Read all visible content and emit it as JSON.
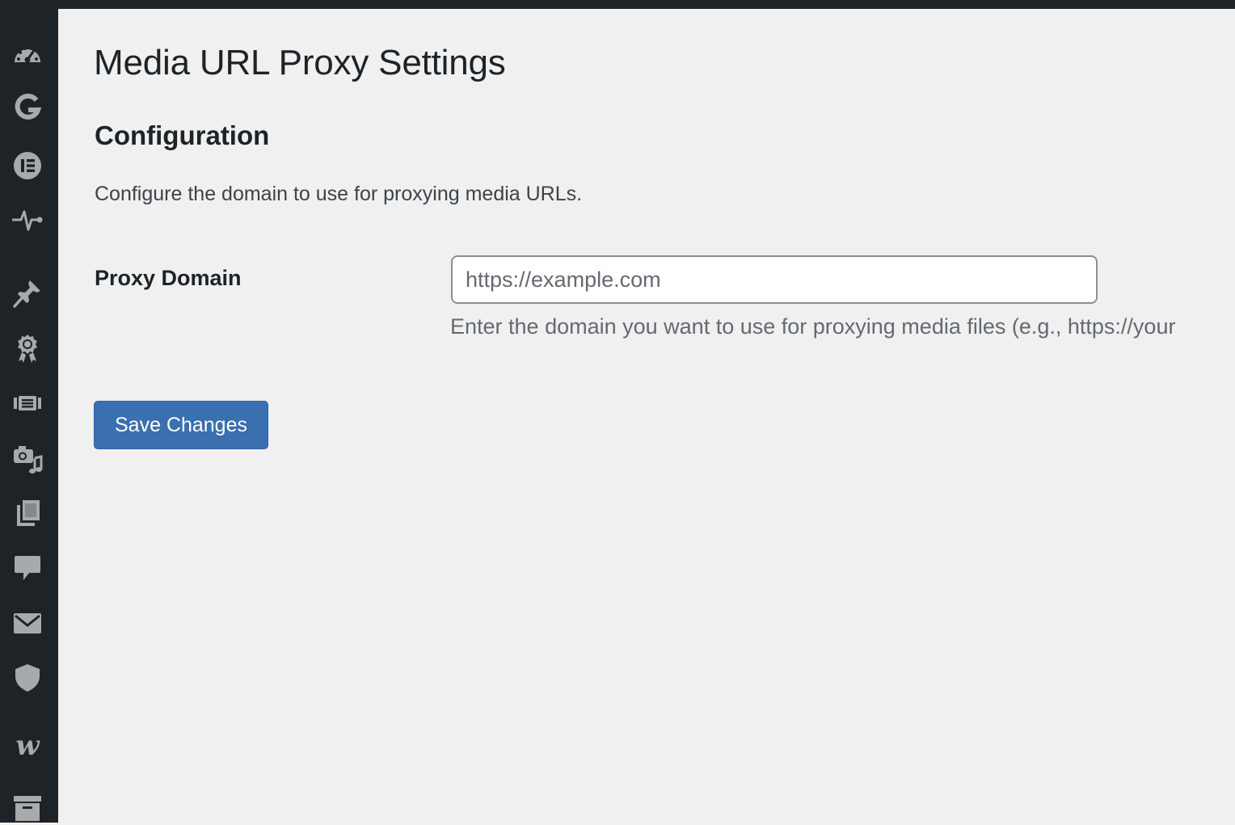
{
  "colors": {
    "sidebar_bg": "#1d2327",
    "page_bg": "#f0f0f1",
    "icon": "#a7aaad",
    "button_bg": "#3a6fb0",
    "button_text": "#ffffff"
  },
  "sidebar": {
    "items": [
      {
        "icon": "dashboard-icon"
      },
      {
        "icon": "google-g-icon"
      },
      {
        "icon": "elementor-icon"
      },
      {
        "icon": "activity-pulse-icon"
      },
      {
        "icon": "pushpin-icon"
      },
      {
        "icon": "award-ribbon-icon"
      },
      {
        "icon": "film-strip-icon"
      },
      {
        "icon": "media-camera-music-icon"
      },
      {
        "icon": "pages-icon"
      },
      {
        "icon": "comment-bubble-icon"
      },
      {
        "icon": "envelope-icon"
      },
      {
        "icon": "shield-icon"
      },
      {
        "icon": "w-logo-icon"
      },
      {
        "icon": "archive-box-icon"
      }
    ]
  },
  "page": {
    "title": "Media URL Proxy Settings"
  },
  "section": {
    "title": "Configuration",
    "description": "Configure the domain to use for proxying media URLs."
  },
  "field": {
    "label": "Proxy Domain",
    "value": "",
    "placeholder": "https://example.com",
    "help": "Enter the domain you want to use for proxying media files (e.g., https://your"
  },
  "actions": {
    "save_label": "Save Changes"
  }
}
